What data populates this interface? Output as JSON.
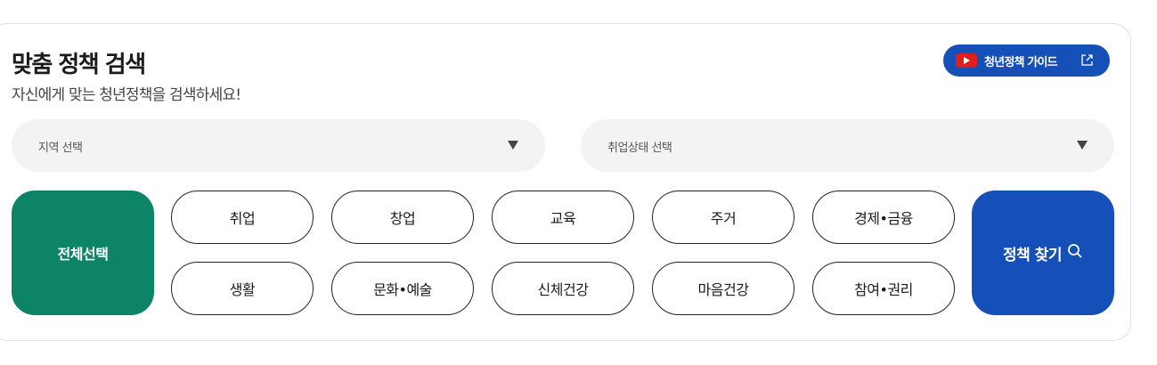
{
  "header": {
    "title": "맞춤 정책 검색",
    "subtitle": "자신에게 맞는 청년정책을 검색하세요!",
    "guide_button": "청년정책 가이드"
  },
  "filters": {
    "region_placeholder": "지역 선택",
    "employment_placeholder": "취업상태 선택"
  },
  "categories": {
    "select_all": "전체선택",
    "row1": [
      "취업",
      "창업",
      "교육",
      "주거",
      "경제•금융"
    ],
    "row2": [
      "생활",
      "문화•예술",
      "신체건강",
      "마음건강",
      "참여•권리"
    ]
  },
  "search_button": "정책 찾기",
  "colors": {
    "primary_blue": "#1550b8",
    "green": "#0e8467",
    "youtube_red": "#e11e1e",
    "select_bg": "#f3f3f3"
  },
  "icons": [
    "youtube-icon",
    "external-link-icon",
    "caret-down-icon",
    "search-icon"
  ]
}
